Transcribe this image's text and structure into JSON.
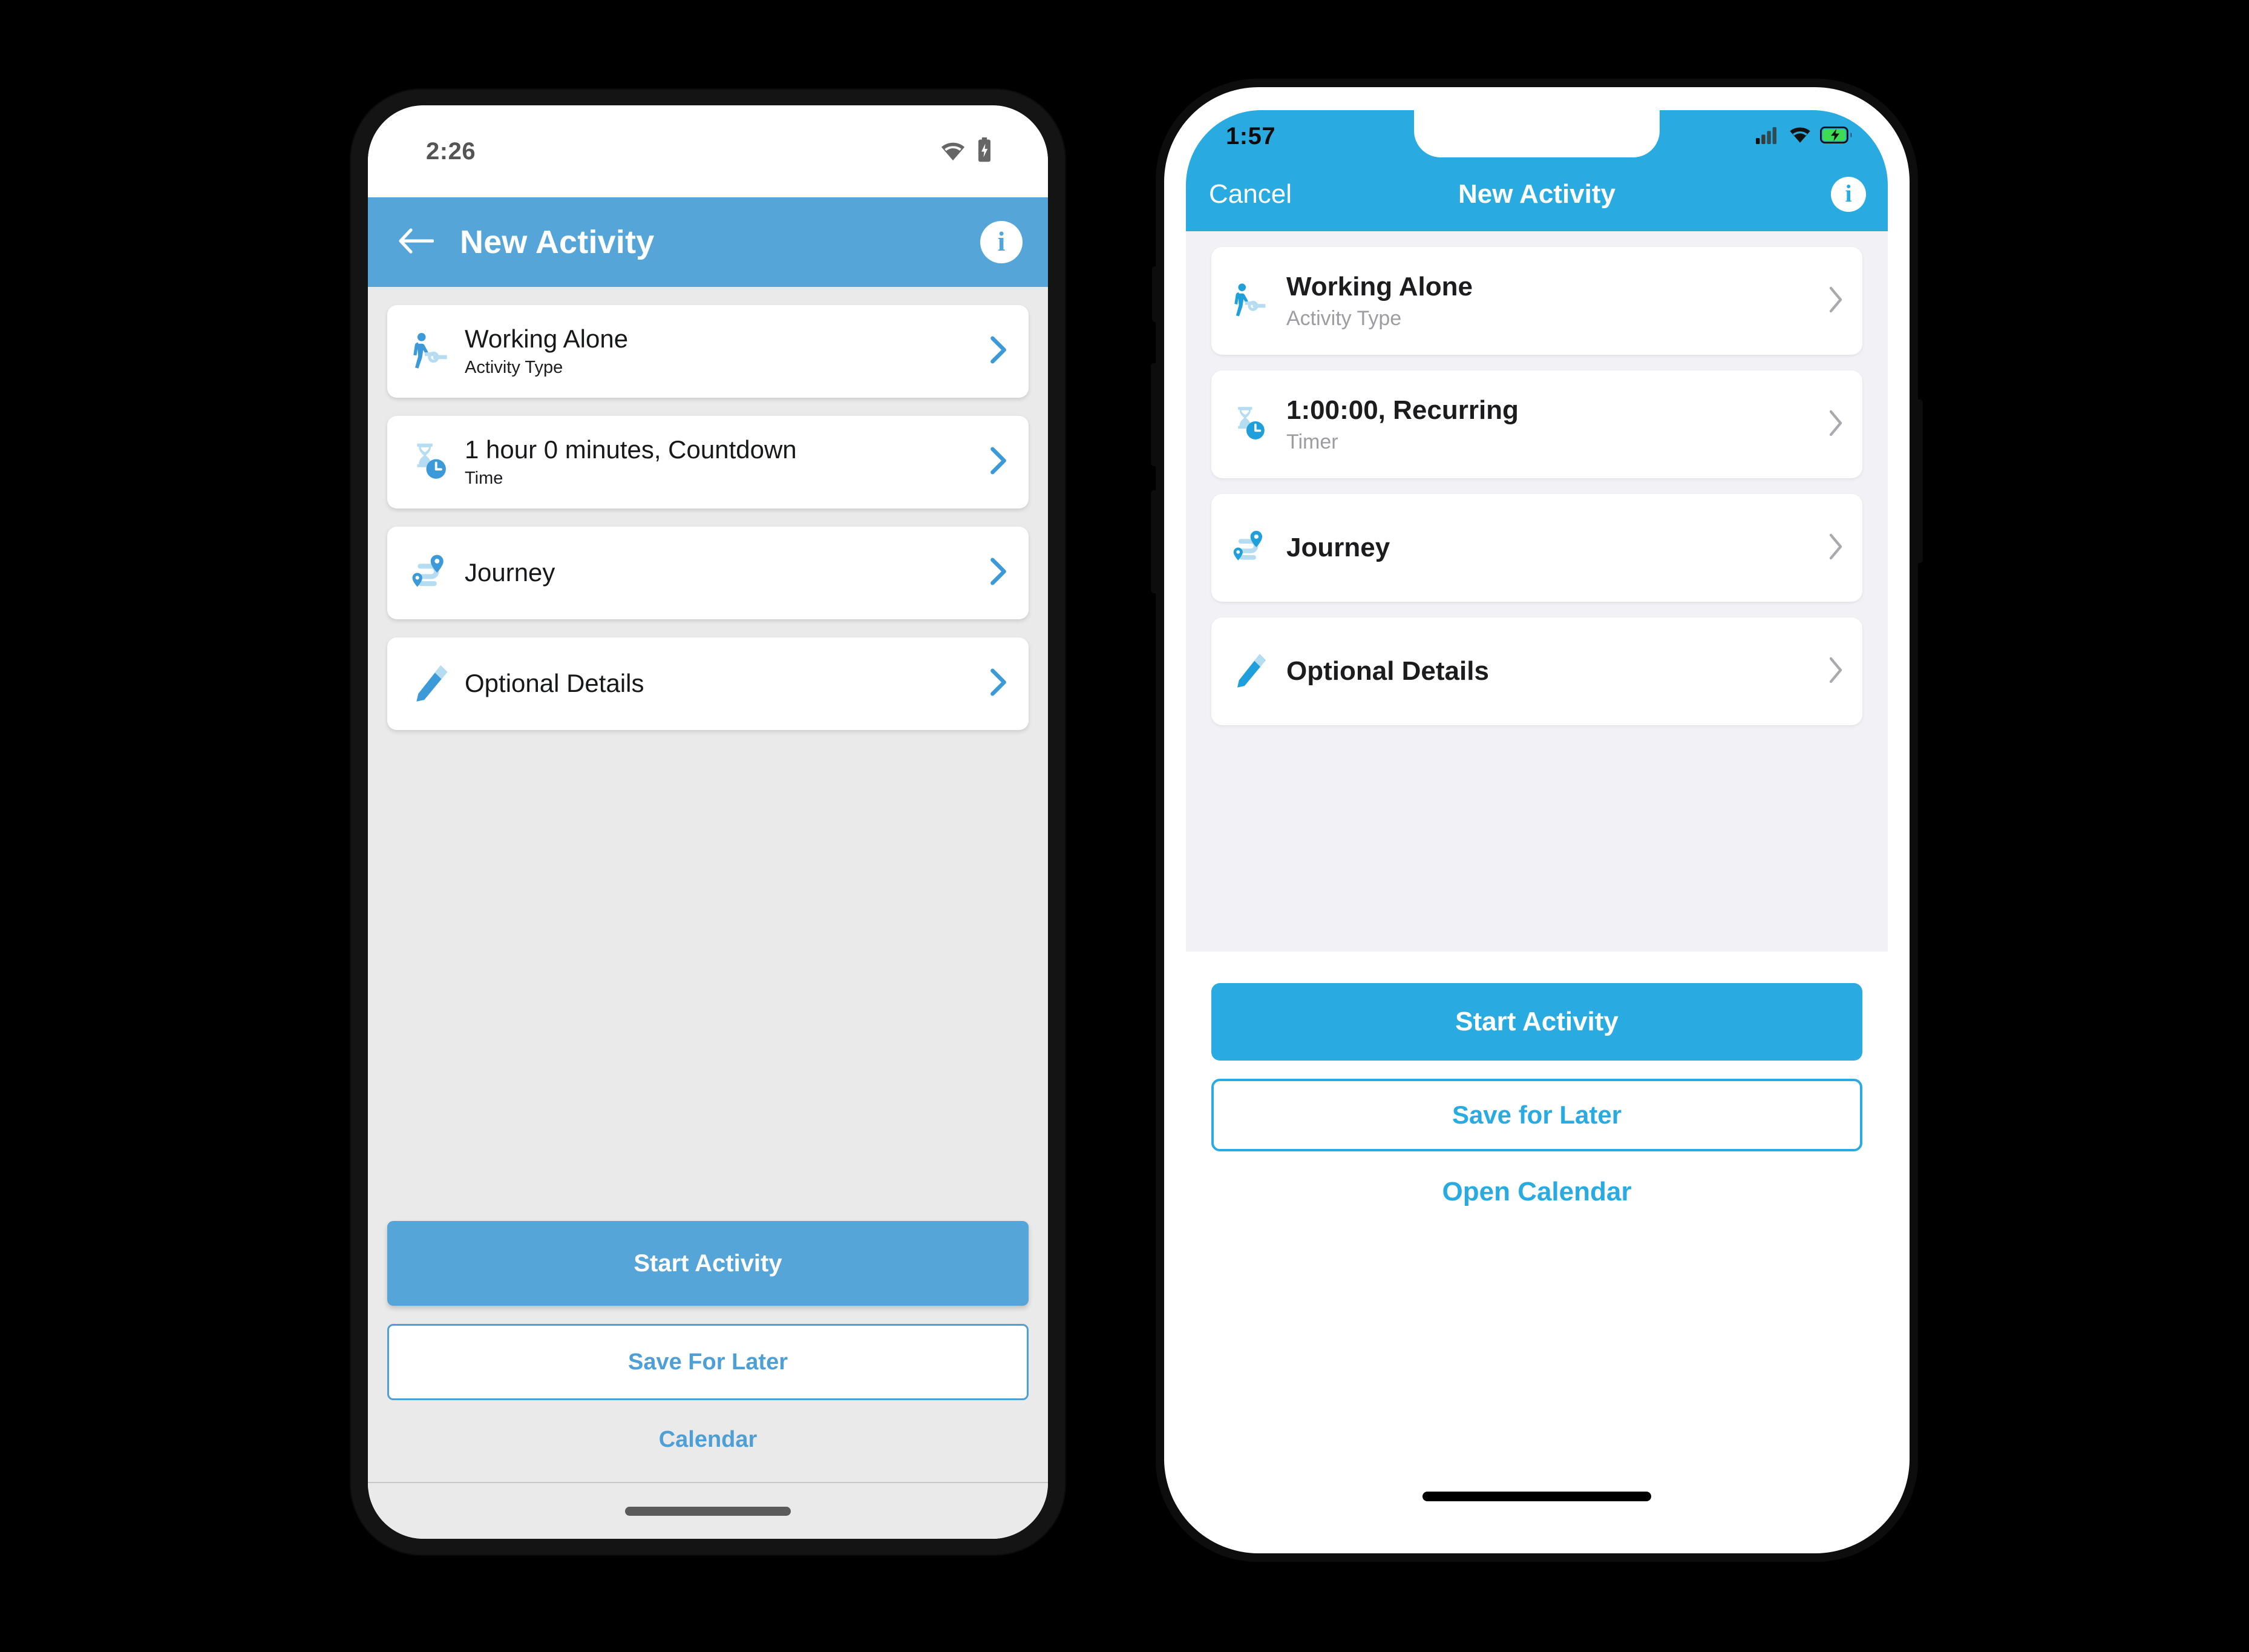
{
  "android": {
    "platform_label": "Android",
    "statusbar": {
      "time": "2:26",
      "icons": [
        "wifi-icon",
        "battery-charging-icon"
      ]
    },
    "appbar": {
      "back_icon": "arrow-left-icon",
      "title": "New Activity",
      "info_icon": "info-icon",
      "info_glyph": "i",
      "background": "#55a5d8"
    },
    "cards": [
      {
        "icon": "working-alone-icon",
        "title": "Working Alone",
        "subtitle": "Activity Type",
        "chevron": "chevron-right-icon"
      },
      {
        "icon": "hourglass-clock-icon",
        "title": "1 hour 0 minutes, Countdown",
        "subtitle": "Time",
        "chevron": "chevron-right-icon"
      },
      {
        "icon": "journey-route-icon",
        "title": "Journey",
        "subtitle": "",
        "chevron": "chevron-right-icon"
      },
      {
        "icon": "pencil-icon",
        "title": "Optional Details",
        "subtitle": "",
        "chevron": "chevron-right-icon"
      }
    ],
    "actions": {
      "primary_label": "Start Activity",
      "secondary_label": "Save For Later",
      "link_label": "Calendar"
    },
    "navbar": {
      "gesture_pill": "home-gesture-pill"
    },
    "colors": {
      "accent": "#55a5d8",
      "link": "#4d9fd6",
      "page_bg": "#eaeaea",
      "card_bg": "#ffffff",
      "title_text": "#17181a"
    }
  },
  "ios": {
    "platform_label": "iOS",
    "statusbar": {
      "time": "1:57",
      "icons": [
        "cellular-signal-icon",
        "wifi-icon",
        "battery-charging-icon"
      ]
    },
    "navbar": {
      "cancel_label": "Cancel",
      "title": "New Activity",
      "info_icon": "info-icon",
      "info_glyph": "i",
      "background": "#29abe2"
    },
    "cards": [
      {
        "icon": "working-alone-icon",
        "title": "Working Alone",
        "subtitle": "Activity Type",
        "chevron": "chevron-right-icon"
      },
      {
        "icon": "hourglass-clock-icon",
        "title": "1:00:00, Recurring",
        "subtitle": "Timer",
        "chevron": "chevron-right-icon"
      },
      {
        "icon": "journey-route-icon",
        "title": "Journey",
        "subtitle": "",
        "chevron": "chevron-right-icon"
      },
      {
        "icon": "pencil-icon",
        "title": "Optional Details",
        "subtitle": "",
        "chevron": "chevron-right-icon"
      }
    ],
    "actions": {
      "primary_label": "Start Activity",
      "secondary_label": "Save for Later",
      "link_label": "Open Calendar"
    },
    "home_indicator": "home-indicator-bar",
    "colors": {
      "accent": "#29abe2",
      "page_bg": "#f1f1f6",
      "footer_bg": "#ffffff",
      "title_text": "#1c1c1e",
      "subtitle_text": "#9c9ca1"
    }
  },
  "canvas": {
    "background": "#000000"
  }
}
